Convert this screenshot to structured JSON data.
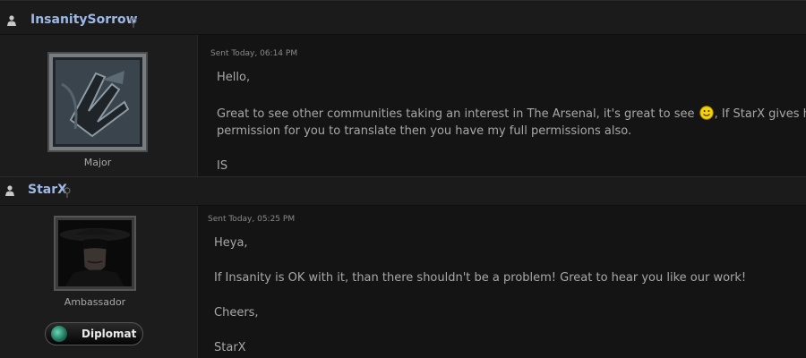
{
  "post1": {
    "username": "InsanitySorrow",
    "rank": "Major",
    "sent": "Sent Today, 06:14 PM",
    "lines": {
      "greeting": "Hello,",
      "body1_a": "Great to see other communities taking an interest in The Arsenal, it's great to see",
      "body1_b": ", If StarX gives his",
      "body2": "permission for you to translate then you have my full permissions also.",
      "sign": "IS"
    }
  },
  "post2": {
    "username": "StarX",
    "rank": "Ambassador",
    "badge": "Diplomat",
    "sent": "Sent Today, 05:25 PM",
    "lines": {
      "greeting": "Heya,",
      "body1": "If Insanity is OK with it, than there shouldn't be a problem! Great to hear you like our work!",
      "closing": "Cheers,",
      "sign": "StarX"
    }
  },
  "icons": {
    "user": "user-silhouette-icon",
    "pin": "location-pin-icon",
    "smiley": "smiley-emoticon-icon",
    "globe": "globe-icon"
  },
  "colors": {
    "username": "#9db8e6",
    "background": "#141414",
    "text": "#a8a8a8"
  }
}
